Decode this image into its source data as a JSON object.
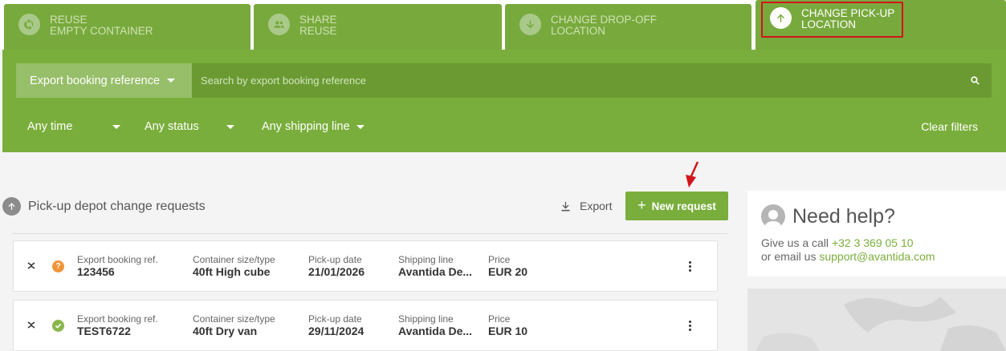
{
  "tabs": [
    {
      "line1": "REUSE",
      "line2": "EMPTY CONTAINER",
      "icon": "refresh-icon"
    },
    {
      "line1": "SHARE",
      "line2": "REUSE",
      "icon": "people-icon"
    },
    {
      "line1": "CHANGE DROP-OFF",
      "line2": "LOCATION",
      "icon": "arrow-down-icon"
    },
    {
      "line1": "CHANGE PICK-UP",
      "line2": "LOCATION",
      "icon": "arrow-up-icon",
      "active": true
    }
  ],
  "search": {
    "selected_type": "Export booking reference",
    "placeholder": "Search by export booking reference",
    "value": ""
  },
  "filters": {
    "time": "Any time",
    "status": "Any status",
    "shipping_line": "Any shipping line",
    "clear_label": "Clear filters"
  },
  "list": {
    "title": "Pick-up depot change requests",
    "export_label": "Export",
    "new_request_label": "New request"
  },
  "columns": {
    "booking": "Export booking ref.",
    "size": "Container size/type",
    "date": "Pick-up date",
    "line": "Shipping line",
    "price": "Price"
  },
  "rows": [
    {
      "status": "pending",
      "status_color": "#f0953a",
      "booking": "123456",
      "size": "40ft High cube",
      "date": "21/01/2026",
      "line": "Avantida De...",
      "price": "EUR 20"
    },
    {
      "status": "approved",
      "status_color": "#8ab54c",
      "booking": "TEST6722",
      "size": "40ft Dry van",
      "date": "29/11/2024",
      "line": "Avantida De...",
      "price": "EUR 10"
    }
  ],
  "help": {
    "title": "Need help?",
    "call_prefix": "Give us a call",
    "phone": "+32 3 369 05 10",
    "email_prefix": "or email us",
    "email": "support@avantida.com"
  },
  "colors": {
    "brand_green": "#7aae3c",
    "highlight_red": "#d3141c"
  }
}
